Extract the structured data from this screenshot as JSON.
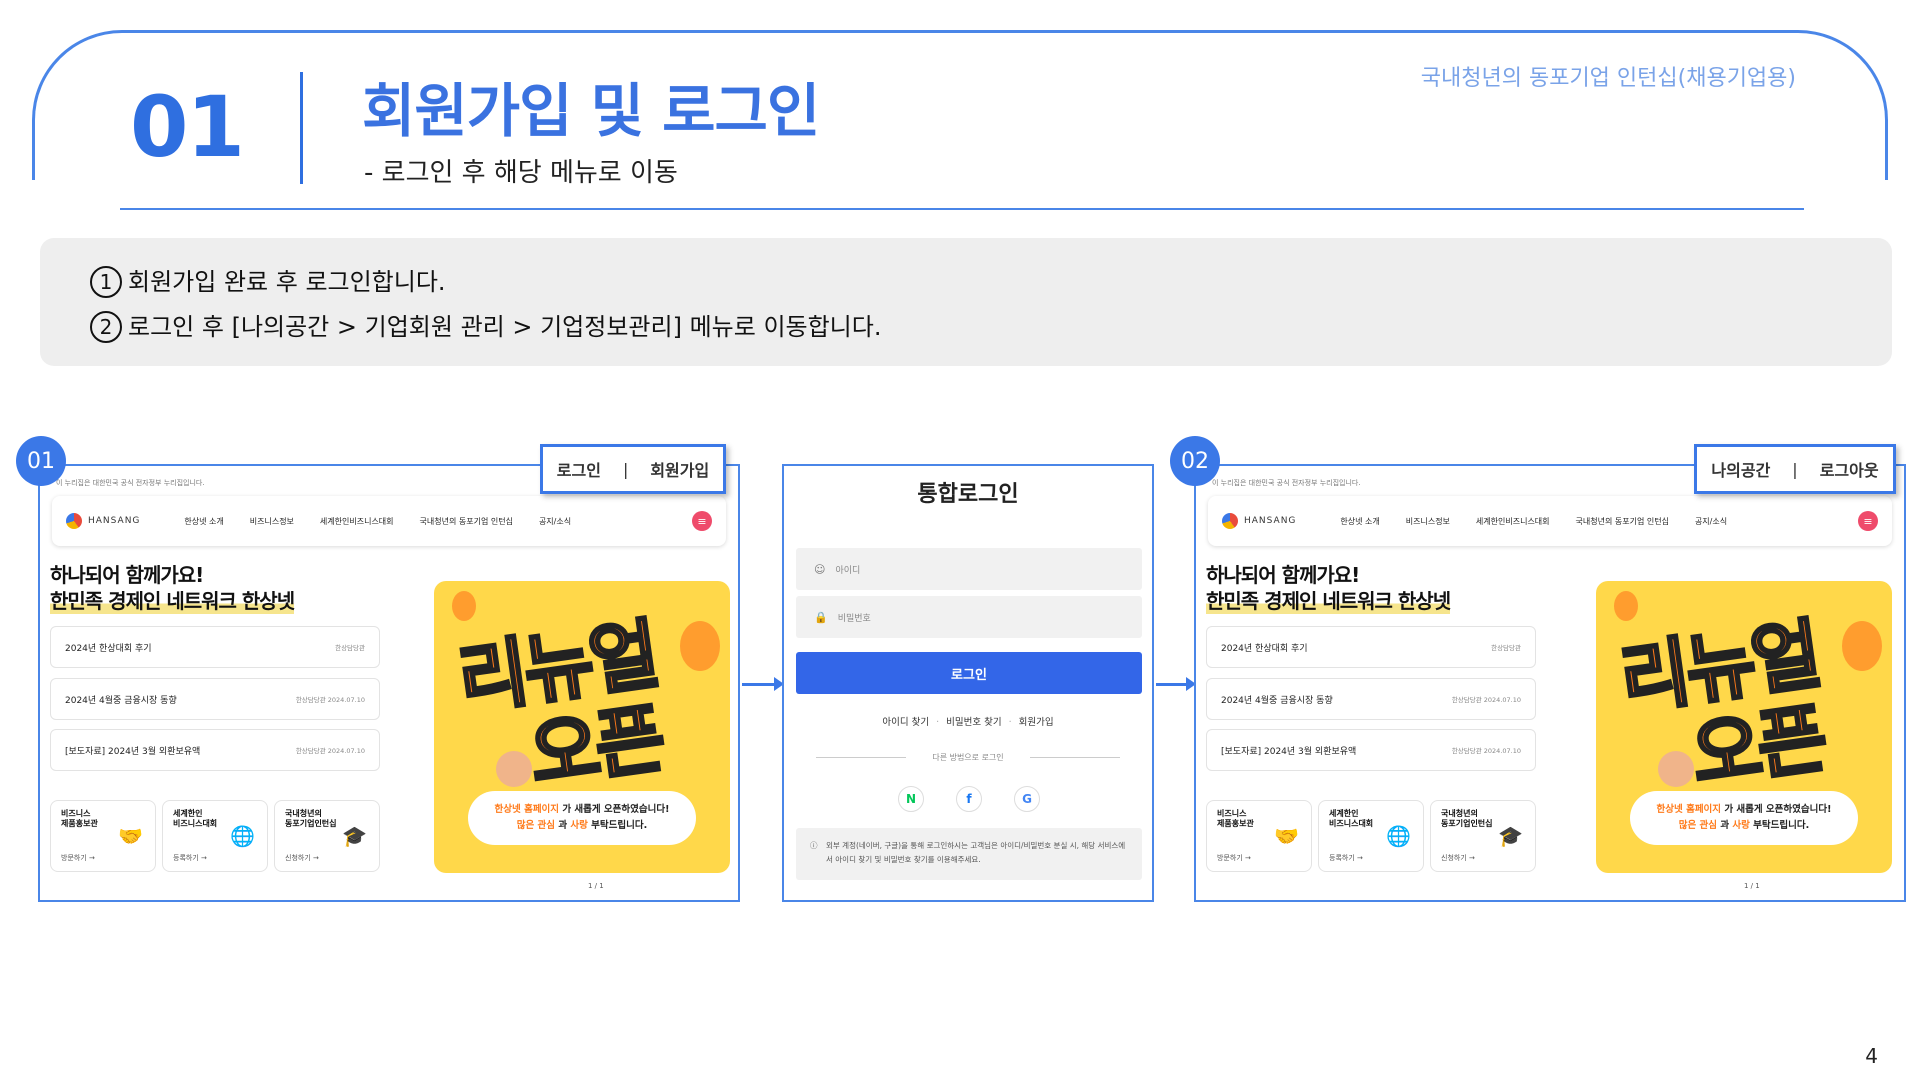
{
  "header": {
    "number": "01",
    "title": "회원가입 및 로그인",
    "subtitle": "- 로그인 후 해당 메뉴로 이동",
    "corner_label": "국내청년의 동포기업 인턴십(채용기업용)",
    "accent_color": "#3a72e0"
  },
  "instructions": [
    {
      "marker": "1",
      "text": "회원가입 완료 후 로그인합니다."
    },
    {
      "marker": "2",
      "text": "로그인 후 [나의공간 > 기업회원 관리 > 기업정보관리] 메뉴로 이동합니다."
    }
  ],
  "screens": {
    "first": {
      "badge": "01",
      "callout_left": "로그인",
      "callout_sep": "|",
      "callout_right": "회원가입"
    },
    "third": {
      "badge": "02",
      "callout_left": "나의공간",
      "callout_sep": "|",
      "callout_right": "로그아웃"
    }
  },
  "site": {
    "top_note": "이 누리집은 대한민국 공식 전자정부 누리집입니다.",
    "logo_text": "HANSANG",
    "nav": [
      "한상넷 소개",
      "비즈니스정보",
      "세계한인비즈니스대회",
      "국내청년의 동포기업 인턴십",
      "공지/소식"
    ],
    "hero_line1": "하나되어 함께가요!",
    "hero_line2": "한민족 경제인 네트워크 한상넷",
    "news": [
      {
        "title": "2024년 한상대회 후기",
        "date": "한상담당관"
      },
      {
        "title": "2024년 4월중 금융시장 동향",
        "date": "한상담당관 2024.07.10"
      },
      {
        "title": "[보도자료] 2024년 3월 외환보유액",
        "date": "한상담당관 2024.07.10"
      }
    ],
    "services": [
      {
        "name1": "비즈니스",
        "name2": "제품홍보관",
        "go": "방문하기 →",
        "icon": "🤝"
      },
      {
        "name1": "세계한인",
        "name2": "비즈니스대회",
        "go": "등록하기 →",
        "icon": "🌐"
      },
      {
        "name1": "국내청년의",
        "name2": "동포기업인턴십",
        "go": "신청하기 →",
        "icon": "🎓"
      }
    ],
    "banner_big1": "리뉴얼",
    "banner_big2": "오픈",
    "banner_msg1_a": "한상넷 홈페이지",
    "banner_msg1_b": " 가 새롭게 오픈하였습니다!",
    "banner_msg2_a": "많은 관심",
    "banner_msg2_b": " 과 ",
    "banner_msg2_c": "사랑",
    "banner_msg2_d": " 부탁드립니다.",
    "pager": "1 / 1"
  },
  "login": {
    "title": "통합로그인",
    "id_placeholder": "아이디",
    "pw_placeholder": "비밀번호",
    "button": "로그인",
    "link_find_id": "아이디 찾기",
    "link_find_pw": "비밀번호 찾기",
    "link_join": "회원가입",
    "dot": "·",
    "other_methods": "다른 방법으로 로그인",
    "social": [
      "N",
      "f",
      "G"
    ],
    "notice": "외부 계정(네이버, 구글)을 통해 로그인하시는 고객님은 아이디/비밀번호 분실 시, 해당 서비스에서 아이디 찾기 및 비밀번호 찾기를 이용해주세요."
  },
  "page_number": "4"
}
